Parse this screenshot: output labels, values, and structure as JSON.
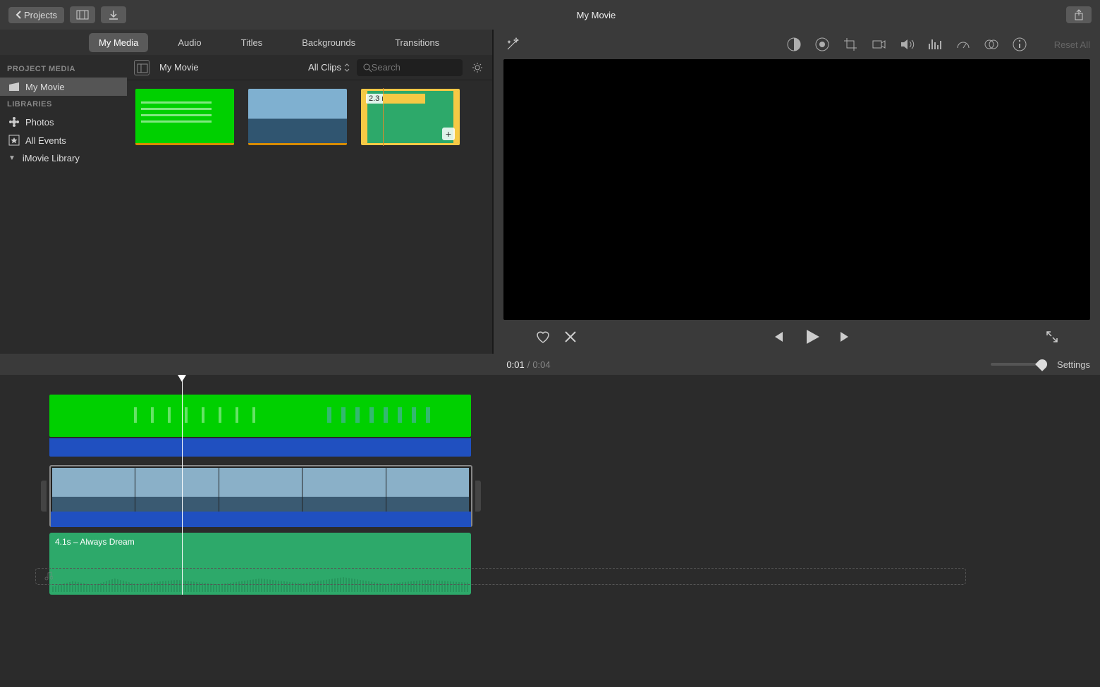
{
  "titlebar": {
    "back_label": "Projects",
    "title": "My Movie"
  },
  "tabs": [
    "My Media",
    "Audio",
    "Titles",
    "Backgrounds",
    "Transitions"
  ],
  "active_tab": 0,
  "sidebar": {
    "project_media_header": "PROJECT MEDIA",
    "project_items": [
      "My Movie"
    ],
    "libraries_header": "LIBRARIES",
    "library_items": [
      {
        "label": "Photos",
        "icon": "photos-icon"
      },
      {
        "label": "All Events",
        "icon": "all-events-icon"
      }
    ],
    "expandable": {
      "label": "iMovie Library",
      "expanded": true
    }
  },
  "browser": {
    "event_name": "My Movie",
    "filter_label": "All Clips",
    "search_placeholder": "Search",
    "clips": [
      {
        "type": "video",
        "style": "green-glitch"
      },
      {
        "type": "video",
        "style": "coast"
      },
      {
        "type": "audio",
        "duration_label": "2.3 m",
        "selected": true
      }
    ]
  },
  "adjust_bar": {
    "icons": [
      "enhance",
      "balance",
      "color",
      "crop",
      "stabilize",
      "volume",
      "eq",
      "speed",
      "filter",
      "info"
    ],
    "reset_label": "Reset All"
  },
  "playback": {
    "current_time": "0:01",
    "duration": "0:04"
  },
  "settings_label": "Settings",
  "timeline": {
    "overlay_clip": {
      "type": "green-screen"
    },
    "main_clip": {
      "type": "coast-video"
    },
    "audio_clip": {
      "label": "4.1s – Always Dream"
    }
  }
}
